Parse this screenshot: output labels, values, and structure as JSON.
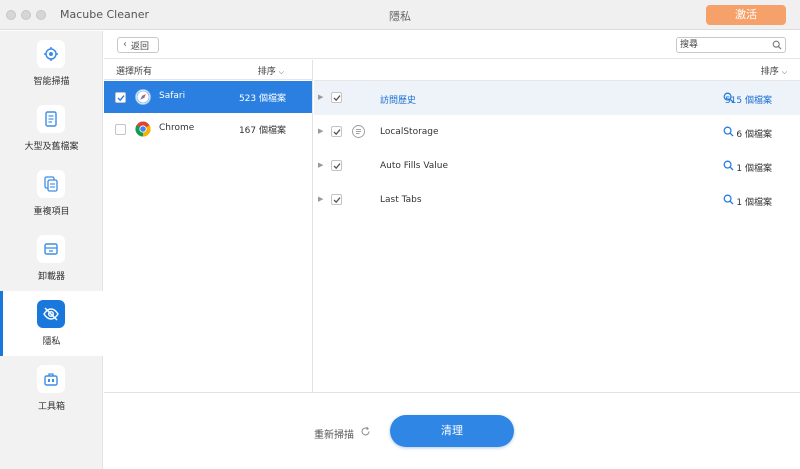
{
  "app": {
    "name": "Macube Cleaner",
    "window_title": "隱私",
    "activate_label": "激活",
    "accent_color": "#1a78dc",
    "activate_color": "#f6a06a"
  },
  "sidebar": {
    "items": [
      {
        "label": "智能掃描",
        "icon": "target-scan-icon"
      },
      {
        "label": "大型及舊檔案",
        "icon": "document-icon"
      },
      {
        "label": "重複項目",
        "icon": "duplicate-files-icon"
      },
      {
        "label": "卸載器",
        "icon": "uninstaller-box-icon"
      },
      {
        "label": "隱私",
        "icon": "eye-slash-icon",
        "active": true
      },
      {
        "label": "工具箱",
        "icon": "toolbox-icon"
      }
    ]
  },
  "toolbar": {
    "back_label": "返回",
    "search_placeholder": "搜尋"
  },
  "browsers": {
    "select_all": "選擇所有",
    "sort_label": "排序",
    "list": [
      {
        "name": "Safari",
        "count": "523 個檔案",
        "checked": true,
        "selected": true,
        "icon": "safari-icon"
      },
      {
        "name": "Chrome",
        "count": "167 個檔案",
        "checked": false,
        "selected": false,
        "icon": "chrome-icon"
      }
    ]
  },
  "items": {
    "sort_label": "排序",
    "list": [
      {
        "name": "訪問歷史",
        "count": "515 個檔案",
        "checked": true,
        "icon": "",
        "highlighted": true
      },
      {
        "name": "LocalStorage",
        "count": "6 個檔案",
        "checked": true,
        "icon": "storage-list-icon",
        "highlighted": false
      },
      {
        "name": "Auto Fills Value",
        "count": "1 個檔案",
        "checked": true,
        "icon": "",
        "highlighted": false
      },
      {
        "name": "Last Tabs",
        "count": "1 個檔案",
        "checked": true,
        "icon": "",
        "highlighted": false
      }
    ]
  },
  "bottom": {
    "rescan_label": "重新掃描",
    "clean_label": "清理"
  }
}
